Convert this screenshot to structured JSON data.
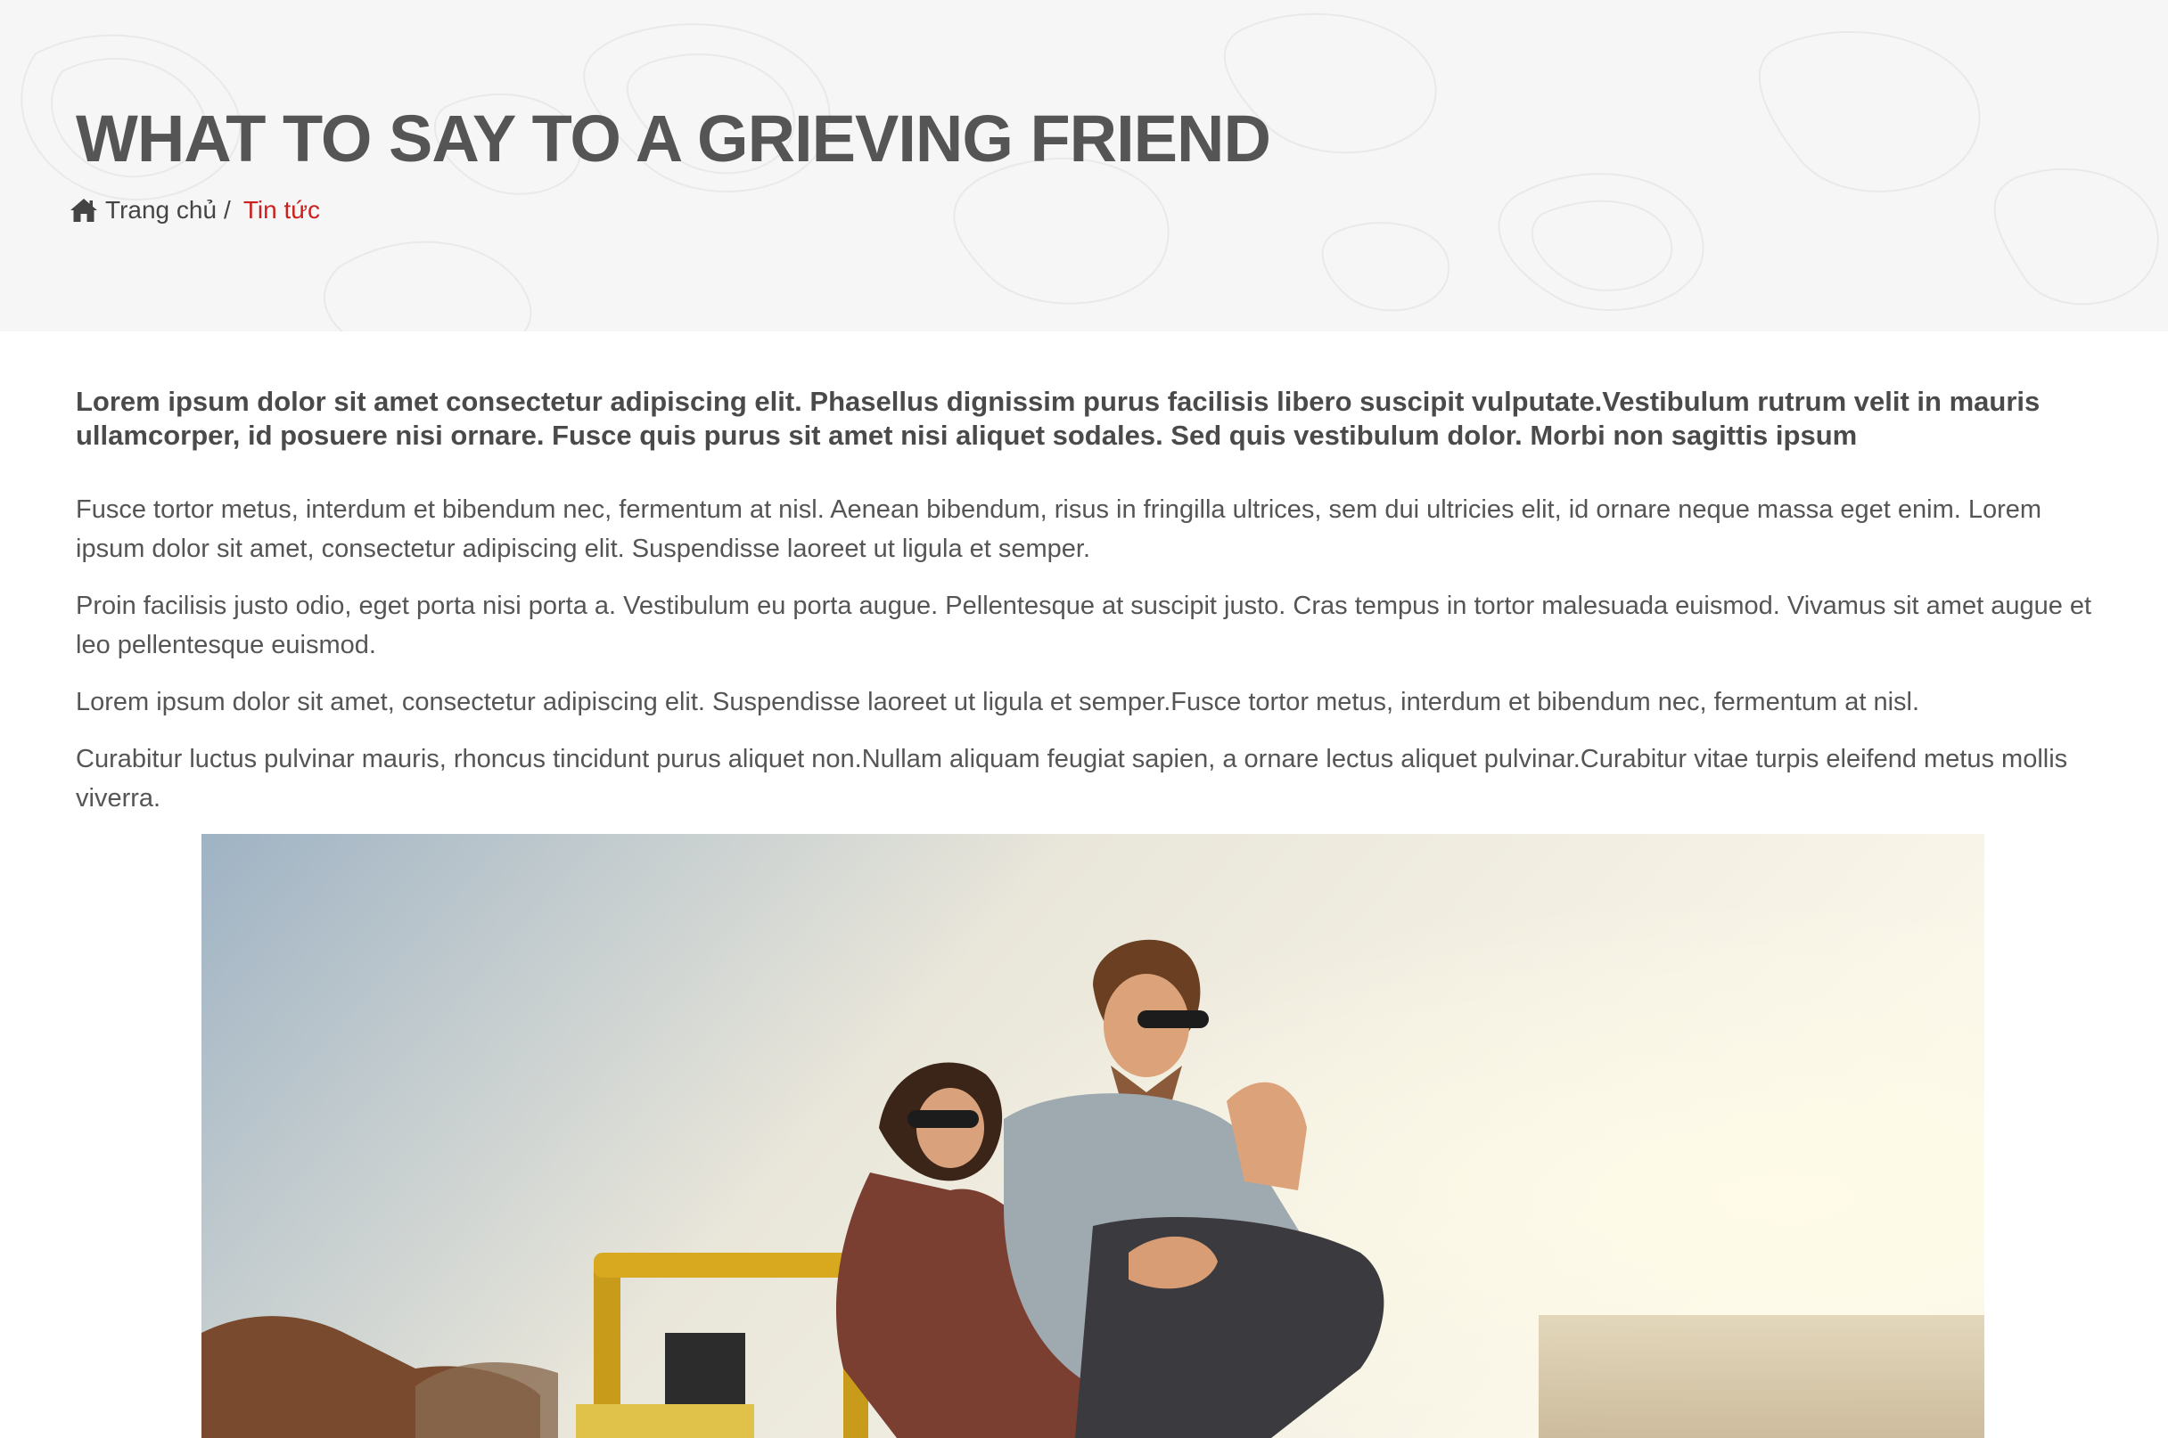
{
  "header": {
    "title": "WHAT TO SAY TO A GRIEVING FRIEND",
    "breadcrumb": {
      "home_icon": "home-icon",
      "home_label": "Trang chủ",
      "separator": "/",
      "current_label": "Tin tức"
    }
  },
  "article": {
    "lead": "Lorem ipsum dolor sit amet consectetur adipiscing elit. Phasellus dignissim purus facilisis libero suscipit vulputate.Vestibulum rutrum velit in mauris ullamcorper, id posuere nisi ornare. Fusce quis purus sit amet nisi aliquet sodales. Sed quis vestibulum dolor. Morbi non sagittis ipsum",
    "paragraphs": [
      "Fusce tortor metus, interdum et bibendum nec, fermentum at nisl. Aenean bibendum, risus in fringilla ultrices, sem dui ultricies elit, id ornare neque massa eget enim. Lorem ipsum dolor sit amet, consectetur adipiscing elit. Suspendisse laoreet ut ligula et semper.",
      "Proin facilisis justo odio, eget porta nisi porta a. Vestibulum eu porta augue. Pellentesque at suscipit justo. Cras tempus in tortor malesuada euismod. Vivamus sit amet augue et leo pellentesque euismod.",
      "Lorem ipsum dolor sit amet, consectetur adipiscing elit. Suspendisse laoreet ut ligula et semper.Fusce tortor metus, interdum et bibendum nec, fermentum at nisl.",
      "Curabitur luctus pulvinar mauris, rhoncus tincidunt purus aliquet non.Nullam aliquam feugiat sapien, a ornare lectus aliquet pulvinar.Curabitur vitae turpis eleifend metus mollis viverra."
    ]
  },
  "colors": {
    "accent": "#cc1f1f",
    "header_bg": "#f6f6f6",
    "text": "#555555"
  }
}
